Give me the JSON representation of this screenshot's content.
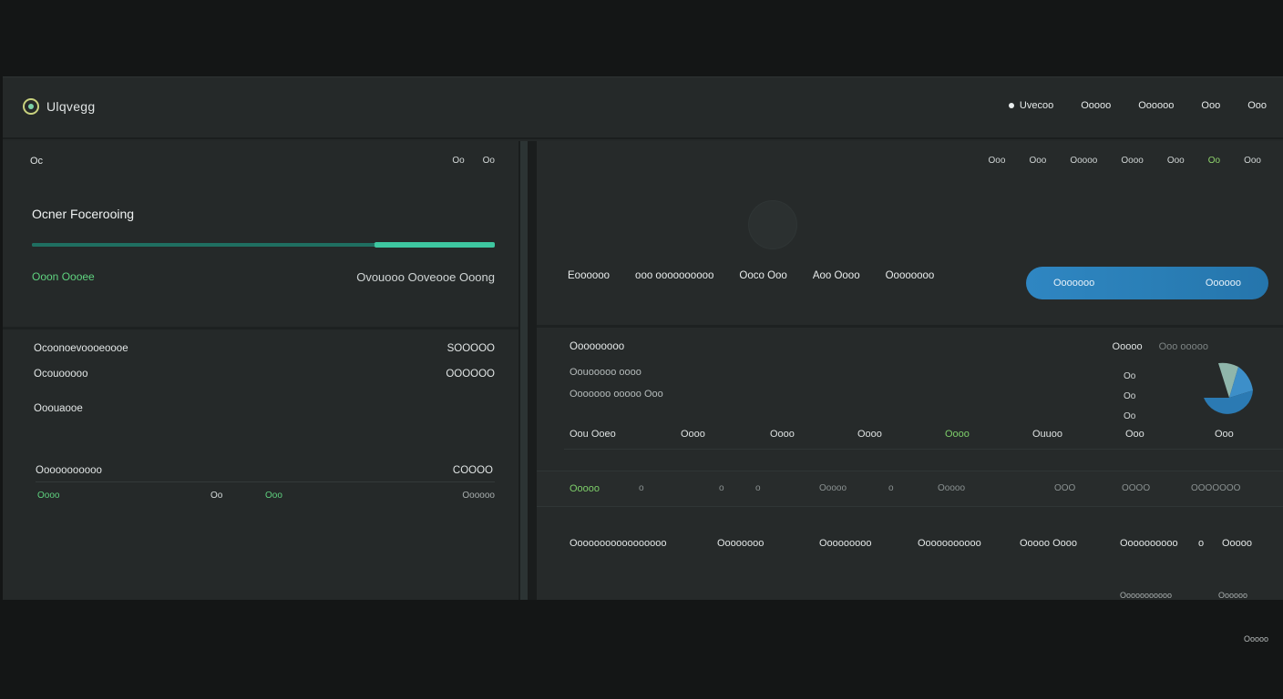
{
  "header": {
    "app_name": "Ulqvegg",
    "nav": [
      "Uvecoo",
      "Ooooo",
      "Oooooo",
      "Ooo",
      "Ooo"
    ]
  },
  "left_panel": {
    "section_label": "Oc",
    "controls": [
      "Oo",
      "Oo"
    ],
    "title": "Ocner Focerooing",
    "progress_percent": 74,
    "status_left": "Ooon Oooee",
    "status_right": "Ovouooo Ooveooe Ooong",
    "summary": [
      {
        "label": "Ocoonoevoooeoooe",
        "value": "SOOOOO"
      },
      {
        "label": "Ocouooooo",
        "value": "OOOOOO"
      },
      {
        "label": "Ooouaooe",
        "value": ""
      }
    ],
    "totals": {
      "label": "Ooooooooooo",
      "value": "COOOO",
      "row": {
        "a": "Oooo",
        "b": "Oo",
        "c": "Ooo",
        "d": "Oooooo"
      }
    }
  },
  "right_panel": {
    "controls": [
      "Ooo",
      "Ooo",
      "Ooooo",
      "Oooo",
      "Ooo",
      "Oo",
      "Ooo"
    ],
    "tabs": [
      "Eoooooo",
      "ooo oooooooooo",
      "Ooco Ooo",
      "Aoo Oooo",
      "Oooooooo"
    ],
    "cta": {
      "left": "Ooooooo",
      "right": "Oooooo"
    },
    "section_title": "Ooooooooo",
    "lines": [
      "Oouooooo oooo",
      "Ooooooo ooooo Ooo"
    ],
    "meta": {
      "label": "Ooooo",
      "dim": "Ooo ooooo"
    },
    "values": [
      "Oo",
      "Oo",
      "Oo"
    ],
    "table_head": [
      "Oou Ooeo",
      "Oooo",
      "Oooo",
      "Oooo",
      "Oooo",
      "Ouuoo",
      "Ooo",
      "Ooo"
    ],
    "band": [
      "Ooooo",
      "o",
      "o",
      "o",
      "Ooooo",
      "o",
      "Ooooo",
      "OOO",
      "OOOO",
      "OOOOOOO"
    ],
    "bottom_head": [
      "Ooooooooooooooooo",
      "Oooooooo",
      "Ooooooooo",
      "Ooooooooooo",
      "Ooooo Oooo",
      "Oooooooooo",
      "o",
      "Ooooo"
    ],
    "bottom_foot": [
      "Ooooooooooo",
      "Oooooo"
    ]
  },
  "footer": {
    "corner_text": "Ooooo"
  },
  "colors": {
    "accent_blue": "#2f86c2",
    "accent_teal": "#3ec7a0",
    "accent_green": "#5fd27f",
    "background": "#141616",
    "panel": "#252929"
  }
}
